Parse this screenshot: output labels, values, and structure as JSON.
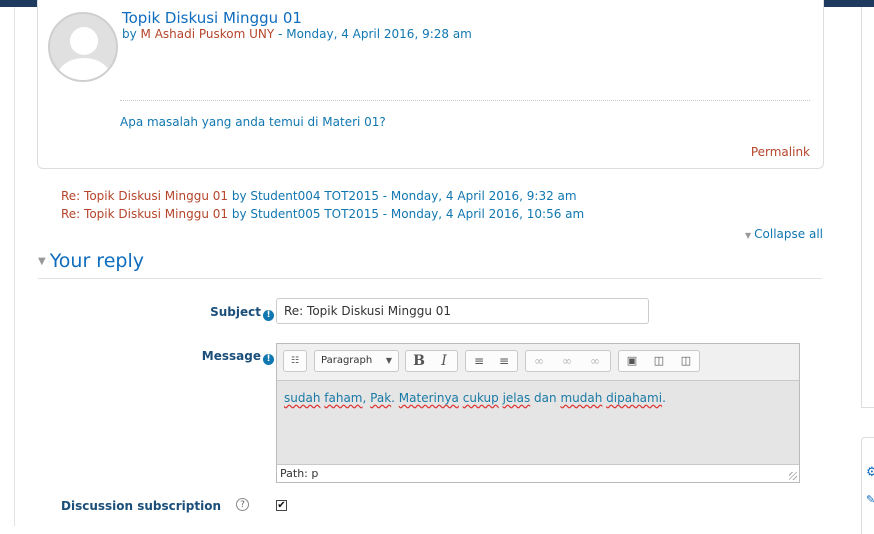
{
  "post": {
    "title": "Topik Diskusi Minggu 01",
    "by_prefix": "by ",
    "author": "M Ashadi Puskom UNY",
    "date": " - Monday, 4 April 2016, 9:28 am",
    "message": "Apa masalah yang anda temui di Materi 01?",
    "permalink_label": "Permalink"
  },
  "replies": [
    {
      "title": "Re: Topik Diskusi Minggu 01",
      "rest": " by Student004 TOT2015 - Monday, 4 April 2016, 9:32 am"
    },
    {
      "title": "Re: Topik Diskusi Minggu 01",
      "rest": " by Student005 TOT2015 - Monday, 4 April 2016, 10:56 am"
    }
  ],
  "collapse_label": "Collapse all",
  "reply_form": {
    "heading": "Your reply",
    "subject_label": "Subject",
    "subject_value": "Re: Topik Diskusi Minggu 01",
    "message_label": "Message",
    "format_select": "Paragraph",
    "message_words": [
      "sudah",
      "faham",
      ", ",
      "Pak",
      ". ",
      "Materinya",
      " ",
      "cukup",
      " ",
      "jelas",
      " dan ",
      "mudah",
      " ",
      "dipahami",
      "."
    ],
    "path_label": "Path: p",
    "subscription_label": "Discussion subscription",
    "subscription_checked": true
  },
  "colors": {
    "accent": "#0f6cbf",
    "link": "#1177b0",
    "author": "#b5452b",
    "topbar": "#1e3a5f"
  }
}
